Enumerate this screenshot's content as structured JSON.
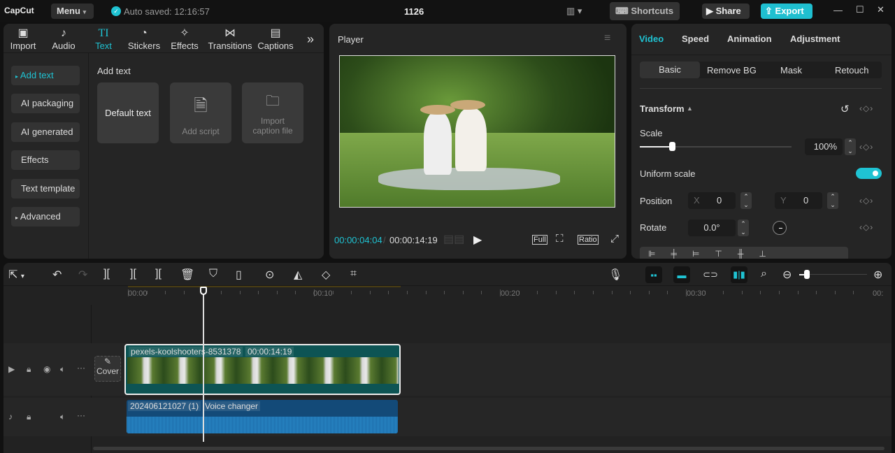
{
  "app": {
    "logo": "CapCut",
    "menu": "Menu",
    "autosave": "Auto saved: 12:16:57",
    "project": "1126",
    "shortcuts": "Shortcuts",
    "share": "Share",
    "export": "Export"
  },
  "media_tabs": [
    {
      "label": "Import",
      "icon": "▣"
    },
    {
      "label": "Audio",
      "icon": "♪"
    },
    {
      "label": "Text",
      "icon": "TI"
    },
    {
      "label": "Stickers",
      "icon": "◔"
    },
    {
      "label": "Effects",
      "icon": "✧"
    },
    {
      "label": "Transitions",
      "icon": "⋈"
    },
    {
      "label": "Captions",
      "icon": "▤"
    }
  ],
  "text_sidebar": [
    "Add text",
    "AI packaging",
    "AI generated",
    "Effects",
    "Text template",
    "Advanced"
  ],
  "text_panel": {
    "heading": "Add text",
    "default": "Default text",
    "script": "Add script",
    "import1": "Import",
    "import2": "caption file"
  },
  "player": {
    "title": "Player",
    "current": "00:00:04:04",
    "total": "00:00:14:19",
    "full": "Full",
    "ratio": "Ratio"
  },
  "inspector": {
    "tabs": [
      "Video",
      "Speed",
      "Animation",
      "Adjustment"
    ],
    "subtabs": [
      "Basic",
      "Remove BG",
      "Mask",
      "Retouch"
    ],
    "section": "Transform",
    "scale_label": "Scale",
    "scale_value": "100%",
    "scale_fraction": 0.21,
    "uniform": "Uniform scale",
    "uniform_on": true,
    "position": "Position",
    "x_label": "X",
    "x": "0",
    "y_label": "Y",
    "y": "0",
    "rotate": "Rotate",
    "rotate_value": "0.0°"
  },
  "timeline": {
    "ticks": [
      "00:00",
      "00:10",
      "00:20",
      "00:30",
      "00:"
    ],
    "cover": "Cover",
    "video_clip": {
      "name": "pexels-koolshooters-8531378",
      "duration": "00:00:14:19"
    },
    "audio_clip": {
      "name": "202406121027 (1)",
      "effect": "Voice changer"
    }
  },
  "colors": {
    "accent": "#1fc3d3",
    "video_clip": "#0d5454",
    "audio_clip": "#134a78"
  }
}
